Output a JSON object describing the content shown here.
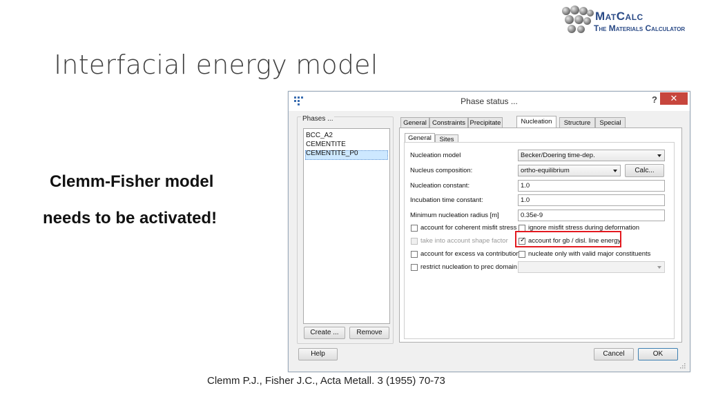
{
  "logo": {
    "line1": "MatCalc",
    "line2": "The Materials Calculator"
  },
  "slide": {
    "title": "Interfacial energy model",
    "note_line1": "Clemm-Fisher model",
    "note_line2": "needs to be activated!",
    "citation": "Clemm P.J., Fisher J.C.,  Acta Metall. 3 (1955) 70-73"
  },
  "window": {
    "title": "Phase status ...",
    "help_glyph": "?",
    "close_glyph": "✕"
  },
  "phases": {
    "label": "Phases ...",
    "items": [
      "BCC_A2",
      "CEMENTITE",
      "CEMENTITE_P0"
    ],
    "selected": "CEMENTITE_P0",
    "create_label": "Create ...",
    "remove_label": "Remove"
  },
  "tabs": [
    "General",
    "Constraints",
    "Precipitate",
    "Nucleation",
    "Structure",
    "Special"
  ],
  "active_tab": "Nucleation",
  "subtabs": [
    "General",
    "Sites"
  ],
  "active_subtab": "General",
  "nucleation": {
    "model_label": "Nucleation model",
    "model_value": "Becker/Doering time-dep.",
    "composition_label": "Nucleus composition:",
    "composition_value": "ortho-equilibrium",
    "calc_label": "Calc...",
    "constant_label": "Nucleation constant:",
    "constant_value": "1.0",
    "incubation_label": "Incubation time constant:",
    "incubation_value": "1.0",
    "min_radius_label": "Minimum nucleation radius [m]",
    "min_radius_value": "0.35e-9",
    "options": {
      "coherent_misfit": {
        "label": "account for coherent misfit stress",
        "checked": false,
        "enabled": true
      },
      "ignore_misfit": {
        "label": "ignore misfit stress during deformation",
        "checked": false,
        "enabled": true
      },
      "shape_factor": {
        "label": "take into account shape factor",
        "checked": false,
        "enabled": false
      },
      "gb_line_energy": {
        "label": "account for gb / disl. line energy",
        "checked": true,
        "enabled": true
      },
      "excess_va": {
        "label": "account for excess va contribution",
        "checked": false,
        "enabled": true
      },
      "valid_major": {
        "label": "nucleate only with valid major constituents",
        "checked": false,
        "enabled": true
      },
      "restrict_prec": {
        "label": "restrict nucleation to prec domain",
        "checked": false,
        "enabled": true
      }
    },
    "prec_domain_value": ""
  },
  "footer": {
    "help_label": "Help",
    "cancel_label": "Cancel",
    "ok_label": "OK"
  },
  "colors": {
    "highlight_box": "#e3191f",
    "close_button": "#c7463d",
    "logo_text": "#2a4a86",
    "selection": "#cde8ff"
  }
}
